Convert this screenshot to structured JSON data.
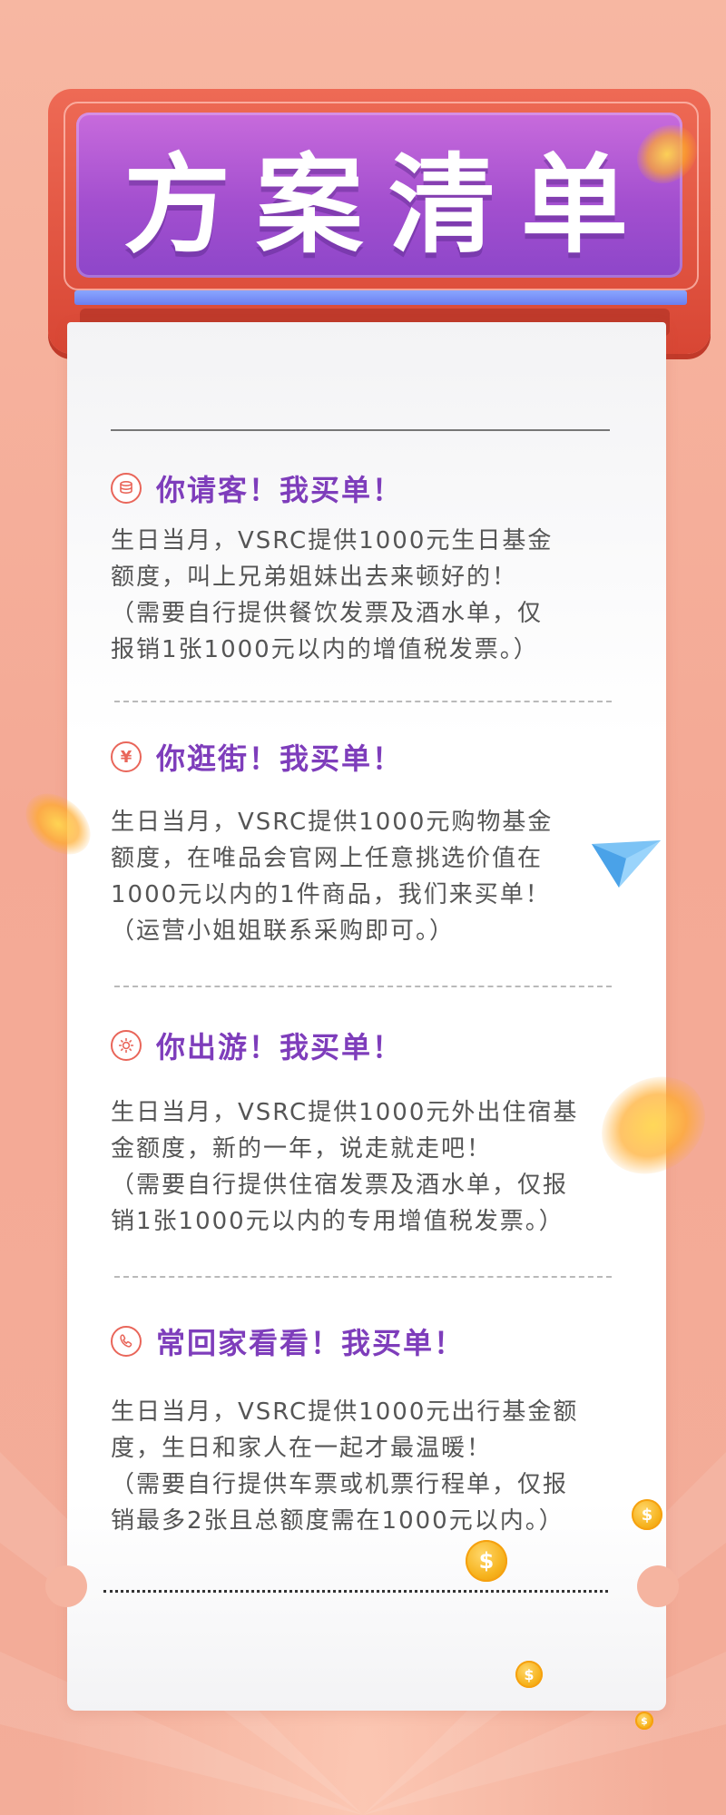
{
  "header": {
    "title": "方案清单"
  },
  "sections": [
    {
      "icon": "coins-stack-icon",
      "title": "你请客！我买单！",
      "lines": [
        "生日当月，VSRC提供1000元生日基金",
        "额度，叫上兄弟姐妹出去来顿好的！",
        "（需要自行提供餐饮发票及酒水单，仅",
        "报销1张1000元以内的增值税发票。）"
      ]
    },
    {
      "icon": "yen-icon",
      "title": "你逛街！我买单！",
      "lines": [
        "生日当月，VSRC提供1000元购物基金",
        "额度，在唯品会官网上任意挑选价值在",
        "1000元以内的1件商品，我们来买单！",
        "（运营小姐姐联系采购即可。）"
      ]
    },
    {
      "icon": "sun-icon",
      "title": "你出游！我买单！",
      "lines": [
        "生日当月，VSRC提供1000元外出住宿基",
        "金额度，新的一年，说走就走吧！",
        "（需要自行提供住宿发票及酒水单，仅报",
        "销1张1000元以内的专用增值税发票。）"
      ]
    },
    {
      "icon": "phone-icon",
      "title": "常回家看看！我买单！",
      "lines": [
        "生日当月，VSRC提供1000元出行基金额",
        "度，生日和家人在一起才最温暖！",
        "（需要自行提供车票或机票行程单，仅报",
        "销最多2张且总额度需在1000元以内。）"
      ]
    }
  ],
  "colors": {
    "title_purple": "#7e3dbb",
    "icon_red": "#e9665a",
    "header_purple": "#a34fcf",
    "frame_red": "#d84634"
  }
}
